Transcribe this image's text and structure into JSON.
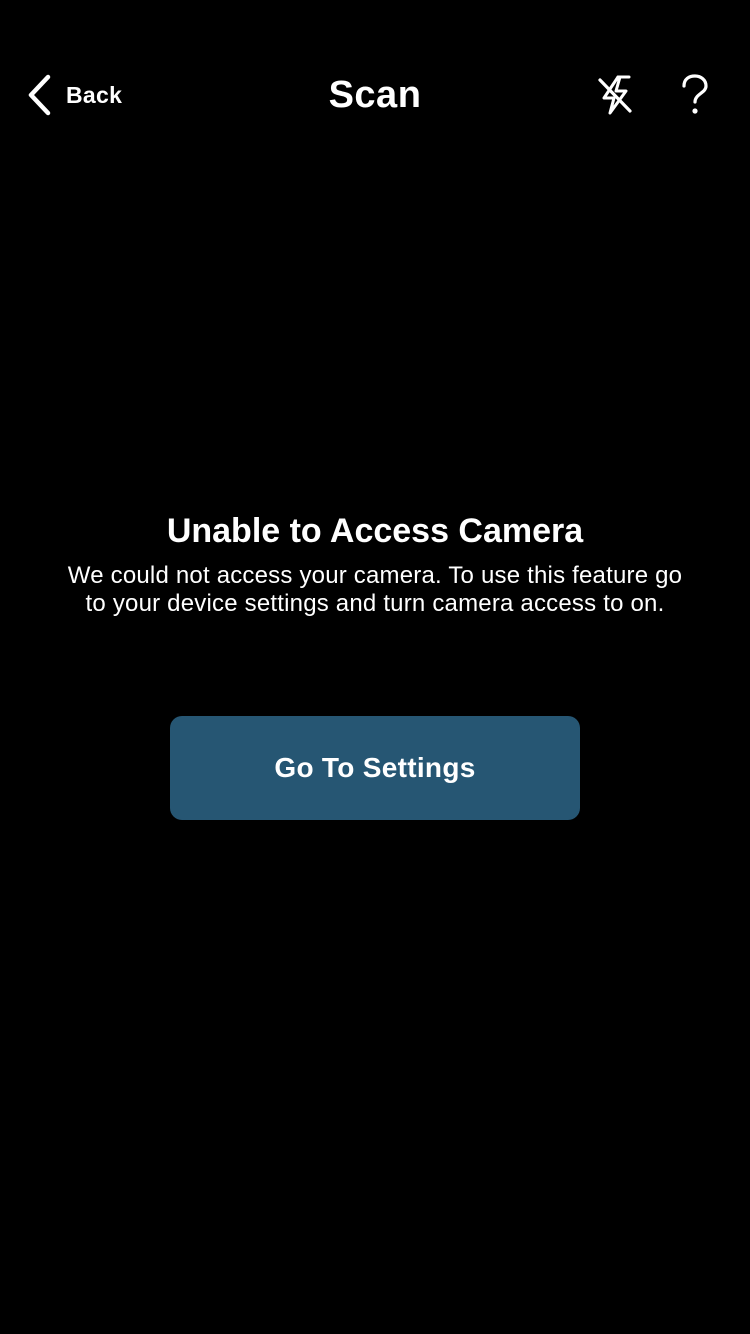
{
  "nav": {
    "back_label": "Back",
    "title": "Scan",
    "flash_icon": "flash-off-icon",
    "help_icon": "question-mark-icon"
  },
  "message": {
    "title": "Unable to Access Camera",
    "body": "We could not access your camera. To use this feature go to your device settings and turn camera access to on."
  },
  "action": {
    "settings_label": "Go To Settings"
  },
  "colors": {
    "background": "#000000",
    "text": "#ffffff",
    "button_background": "#265673"
  }
}
